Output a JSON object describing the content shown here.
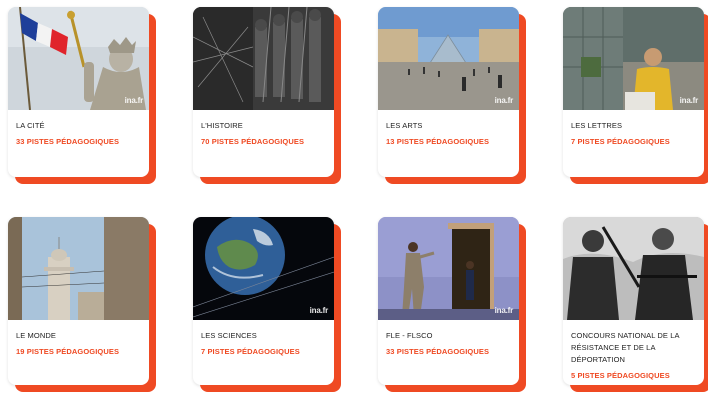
{
  "colors": {
    "accent": "#ef4a23",
    "card_bg": "#ffffff",
    "text": "#222222"
  },
  "watermark": "ina.fr",
  "cards": [
    {
      "title": "LA CITÉ",
      "count": "33 PISTES PÉDAGOGIQUES",
      "image": "statue with french flag"
    },
    {
      "title": "L'HISTOIRE",
      "count": "70 PISTES PÉDAGOGIQUES",
      "image": "marching soldiers"
    },
    {
      "title": "LES ARTS",
      "count": "13 PISTES PÉDAGOGIQUES",
      "image": "louvre pyramid"
    },
    {
      "title": "LES LETTRES",
      "count": "7 PISTES PÉDAGOGIQUES",
      "image": "woman in office"
    },
    {
      "title": "LE MONDE",
      "count": "19 PISTES PÉDAGOGIQUES",
      "image": "minaret street"
    },
    {
      "title": "LES SCIENCES",
      "count": "7 PISTES PÉDAGOGIQUES",
      "image": "earth in space"
    },
    {
      "title": "FLE - FLSCO",
      "count": "33 PISTES PÉDAGOGIQUES",
      "image": "stage performers"
    },
    {
      "title": "CONCOURS NATIONAL DE LA RÉSISTANCE ET DE LA DÉPORTATION",
      "count": "5 PISTES PÉDAGOGIQUES",
      "image": "resistance fighters"
    }
  ]
}
